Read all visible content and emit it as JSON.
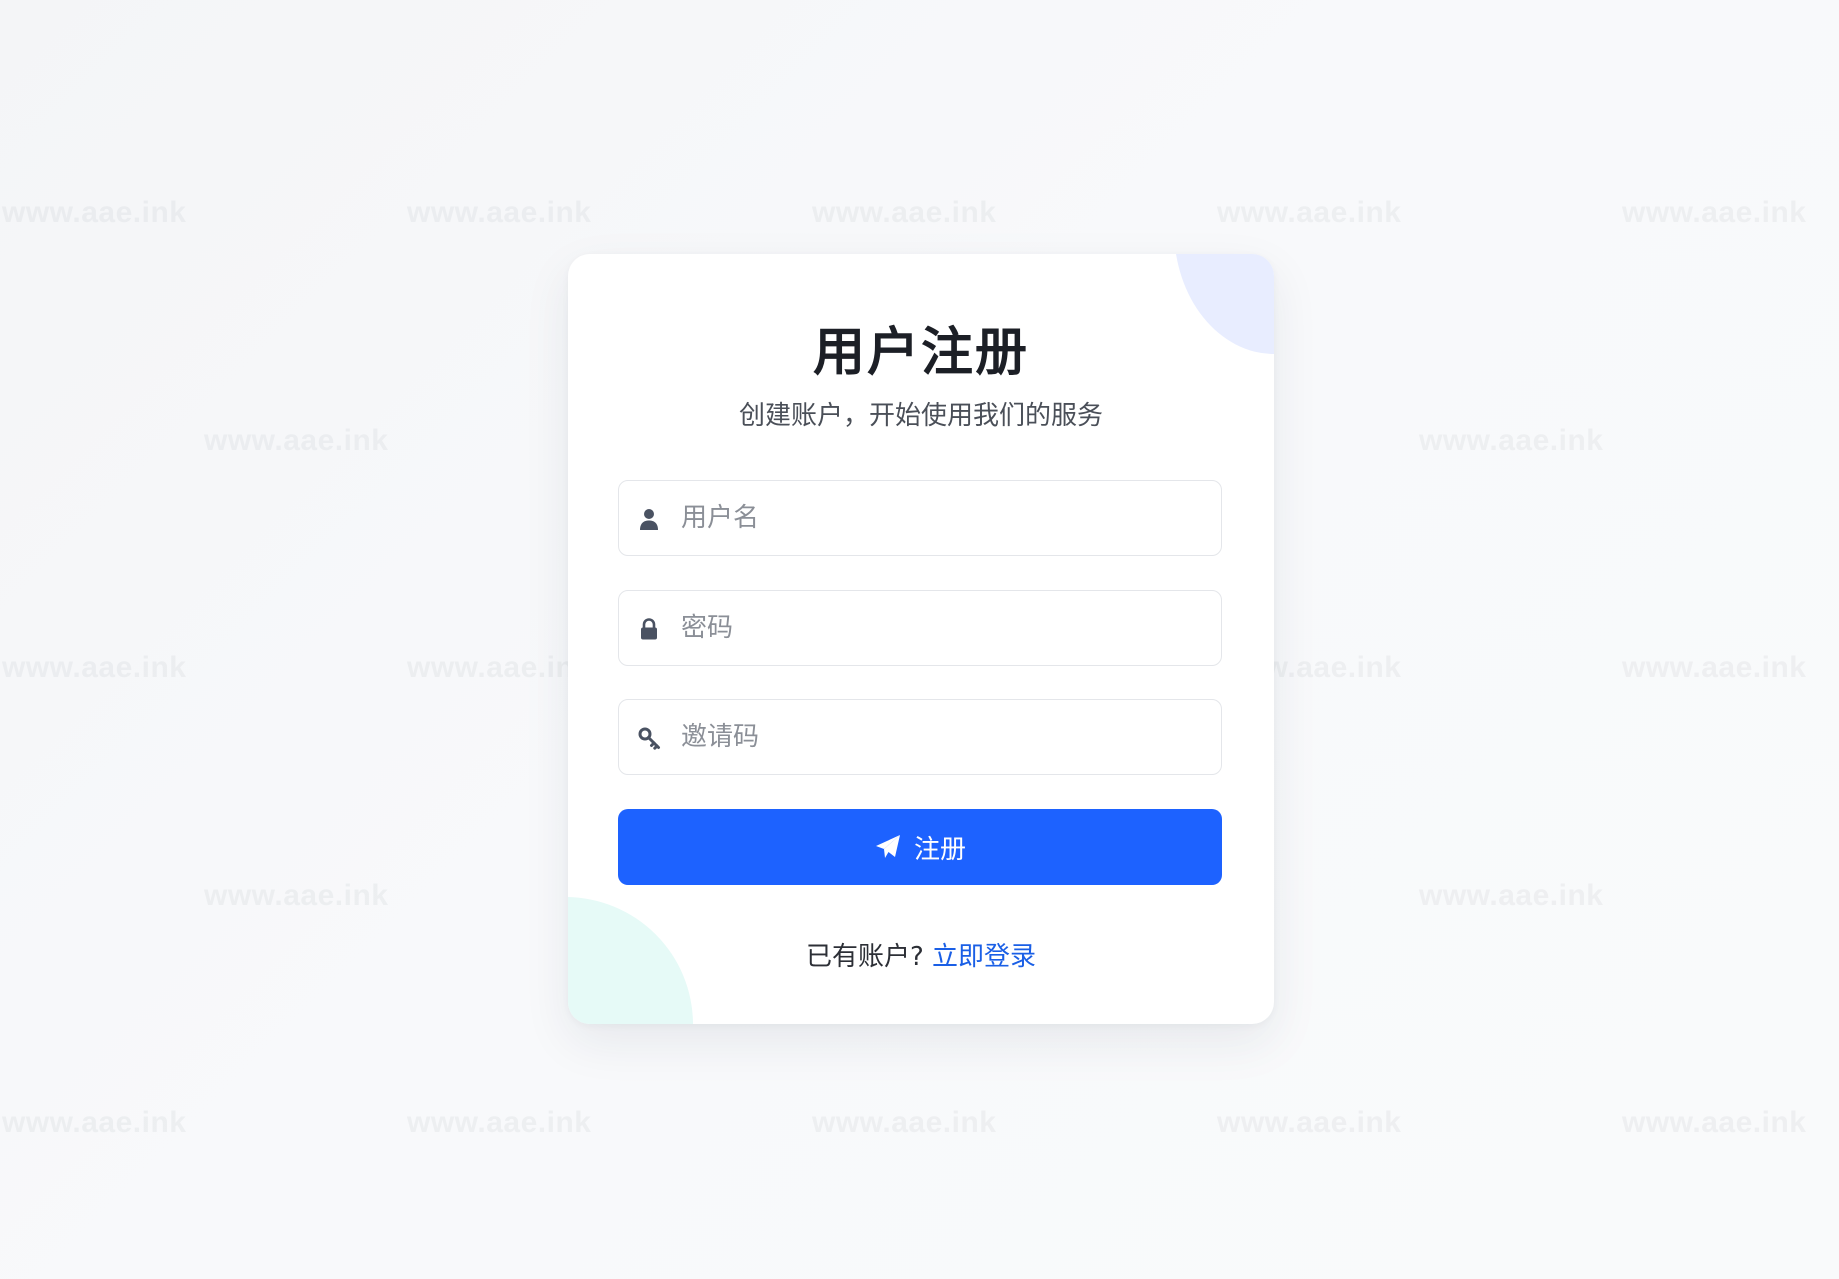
{
  "watermark": {
    "text": "www.aae.ink"
  },
  "form": {
    "title": "用户注册",
    "subtitle": "创建账户，开始使用我们的服务",
    "fields": [
      {
        "icon": "user-icon",
        "placeholder": "用户名",
        "value": ""
      },
      {
        "icon": "lock-icon",
        "placeholder": "密码",
        "value": ""
      },
      {
        "icon": "key-icon",
        "placeholder": "邀请码",
        "value": ""
      }
    ],
    "submit_label": "注册",
    "submit_icon": "paper-plane-icon",
    "footer_text": "已有账户?",
    "login_link": "立即登录"
  },
  "colors": {
    "primary": "#1d62ff",
    "link": "#1a5fe6",
    "title": "#1c1f26",
    "accent_blob_top": "#e8edff",
    "accent_blob_bottom": "#e6faf7"
  }
}
